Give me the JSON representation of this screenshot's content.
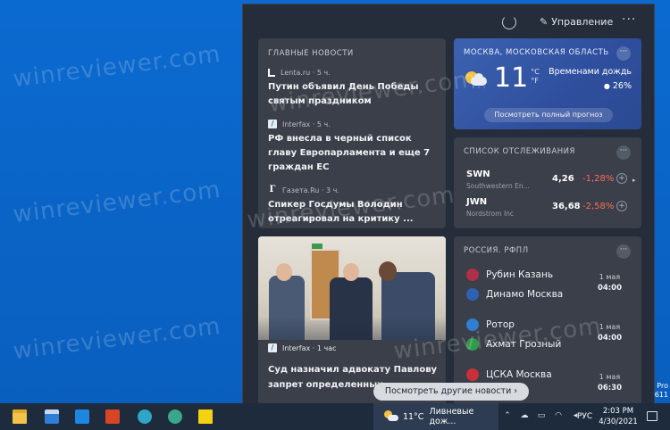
{
  "panel": {
    "manage_label": "Управление",
    "more_label": "···"
  },
  "top_news": {
    "title": "ГЛАВНЫЕ НОВОСТИ",
    "items": [
      {
        "source": "Lenta.ru · 5 ч.",
        "icon": "lenta-logo-icon",
        "headline": "Путин объявил День Победы святым праздником"
      },
      {
        "source": "Interfax · 5 ч.",
        "icon": "interfax-logo-icon",
        "headline": "РФ внесла в черный список главу Европарламента и еще 7 граждан ЕС"
      },
      {
        "source": "Газета.Ru · 3 ч.",
        "icon": "gazeta-logo-icon",
        "headline": "Спикер Госдумы Володин отреагировал на критику ..."
      }
    ]
  },
  "weather": {
    "location": "МОСКВА, МОСКОВСКАЯ ОБЛАСТЬ",
    "temperature": "11",
    "unit_c": "°C",
    "unit_f": "°F",
    "condition": "Временами дождь",
    "precipitation": "26%",
    "forecast_button": "Посмотреть полный прогноз",
    "more_label": "···"
  },
  "watchlist": {
    "title": "СПИСОК ОТСЛЕЖИВАНИЯ",
    "more_label": "···",
    "stocks": [
      {
        "symbol": "SWN",
        "name": "Southwestern En...",
        "price": "4,26",
        "change": "-1,28%"
      },
      {
        "symbol": "JWN",
        "name": "Nordstrom Inc",
        "price": "36,68",
        "change": "-2,58%"
      }
    ],
    "next_arrow": "▸",
    "add_symbol": "+"
  },
  "photo_news": {
    "source": "Interfax · 1 час",
    "headline": "Суд назначил адвокату Павлову запрет определенных ..."
  },
  "sports": {
    "title": "РОССИЯ. РФПЛ",
    "more_label": "···",
    "matches": [
      {
        "home": "Рубин Казань",
        "away": "Динамо Москва",
        "date": "1 мая",
        "time": "04:00",
        "home_color": "#b0304a",
        "away_color": "#2c62b0"
      },
      {
        "home": "Ротор",
        "away": "Ахмат Грозный",
        "date": "1 мая",
        "time": "04:00",
        "home_color": "#2f7fd0",
        "away_color": "#2f9a4a"
      },
      {
        "home": "ЦСКА Москва",
        "away": "",
        "date": "1 мая",
        "time": "06:30",
        "home_color": "#c8303a",
        "away_color": ""
      }
    ]
  },
  "more_news_button": "Посмотреть другие новости  ›",
  "taskbar": {
    "weather_temp": "11°C",
    "weather_text": "Ливневые дож...",
    "lang": "РУС",
    "time": "2:03 PM",
    "date": "4/30/2021"
  },
  "desktop": {
    "watermark": "winreviewer.com",
    "pro_text_1": "Pro",
    "pro_text_2": "611"
  },
  "colors": {
    "accent_blue": "#0a64c8",
    "panel_bg": "#252d3a",
    "card_bg": "#3a3f49",
    "negative": "#ff6b5e"
  }
}
